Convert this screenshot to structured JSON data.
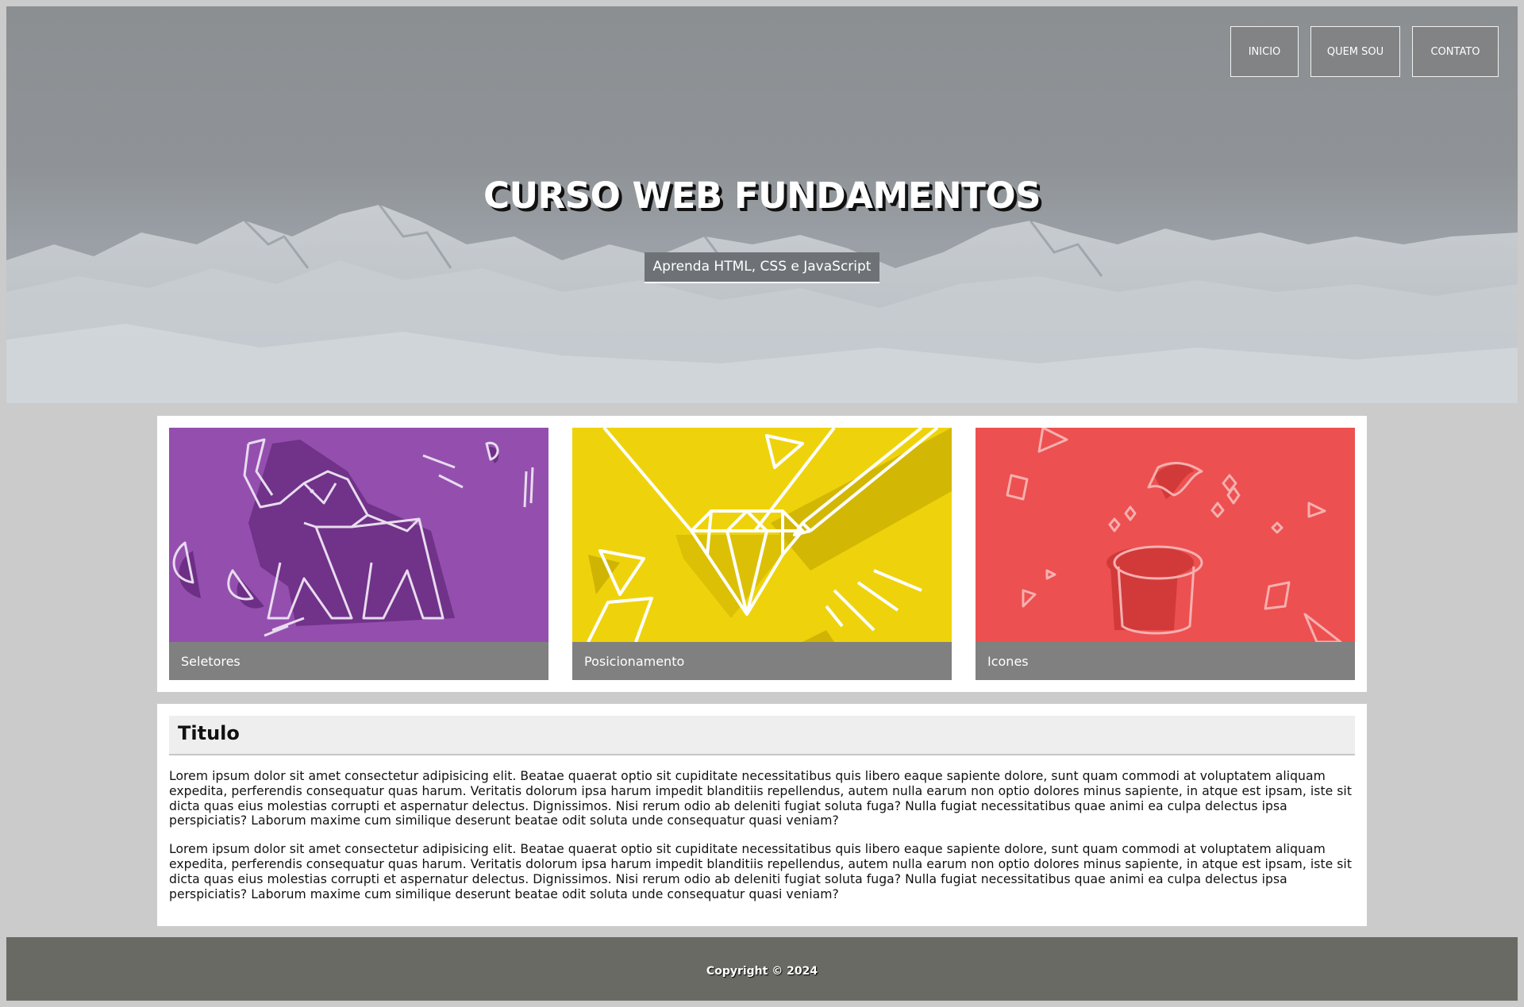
{
  "nav": {
    "items": [
      {
        "label": "INICIO"
      },
      {
        "label": "QUEM SOU"
      },
      {
        "label": "CONTATO"
      }
    ]
  },
  "hero": {
    "title": "CURSO WEB FUNDAMENTOS",
    "subtitle": "Aprenda HTML, CSS e JavaScript"
  },
  "cards": [
    {
      "label": "Seletores",
      "color": "#944fae",
      "icon": "origami-elephant-icon"
    },
    {
      "label": "Posicionamento",
      "color": "#eed30c",
      "icon": "diamond-pencil-icon"
    },
    {
      "label": "Icones",
      "color": "#ed5050",
      "icon": "magic-hat-bird-icon"
    }
  ],
  "article": {
    "title": "Titulo",
    "paragraphs": [
      "Lorem ipsum dolor sit amet consectetur adipisicing elit. Beatae quaerat optio sit cupiditate necessitatibus quis libero eaque sapiente dolore, sunt quam commodi at voluptatem aliquam expedita, perferendis consequatur quas harum. Veritatis dolorum ipsa harum impedit blanditiis repellendus, autem nulla earum non optio dolores minus sapiente, in atque est ipsam, iste sit dicta quas eius molestias corrupti et aspernatur delectus. Dignissimos. Nisi rerum odio ab deleniti fugiat soluta fuga? Nulla fugiat necessitatibus quae animi ea culpa delectus ipsa perspiciatis? Laborum maxime cum similique deserunt beatae odit soluta unde consequatur quasi veniam?",
      "Lorem ipsum dolor sit amet consectetur adipisicing elit. Beatae quaerat optio sit cupiditate necessitatibus quis libero eaque sapiente dolore, sunt quam commodi at voluptatem aliquam expedita, perferendis consequatur quas harum. Veritatis dolorum ipsa harum impedit blanditiis repellendus, autem nulla earum non optio dolores minus sapiente, in atque est ipsam, iste sit dicta quas eius molestias corrupti et aspernatur delectus. Dignissimos. Nisi rerum odio ab deleniti fugiat soluta fuga? Nulla fugiat necessitatibus quae animi ea culpa delectus ipsa perspiciatis? Laborum maxime cum similique deserunt beatae odit soluta unde consequatur quasi veniam?"
    ]
  },
  "footer": {
    "copyright": "Copyright © 2024"
  }
}
